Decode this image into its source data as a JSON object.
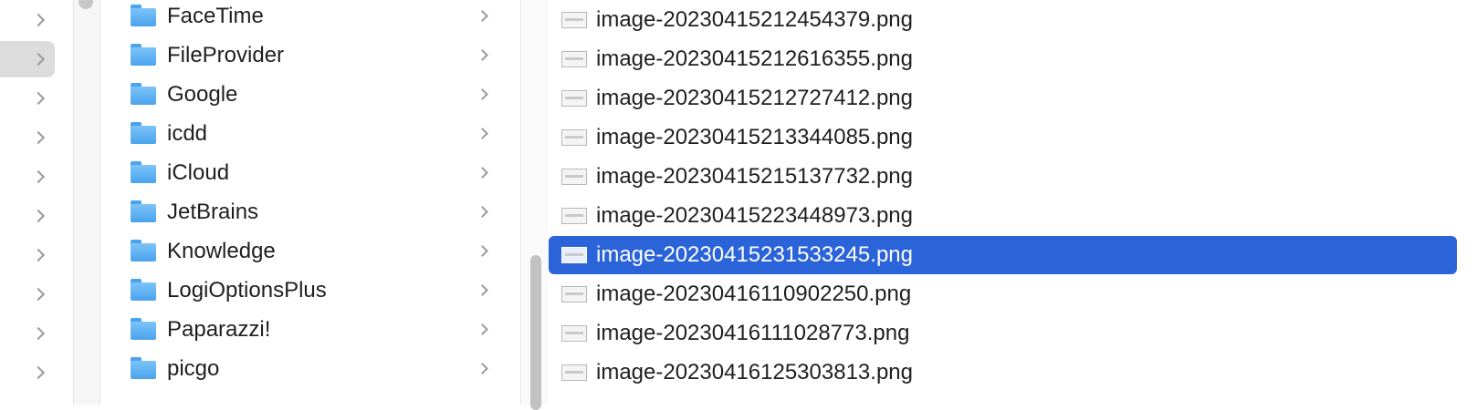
{
  "colors": {
    "selection": "#2b63d9",
    "folder": "#4aa3ec",
    "sidebar_selected": "#dcdcdc"
  },
  "column1": {
    "selected_index": 1,
    "rows": [
      "",
      "",
      "",
      "",
      "",
      "",
      "",
      "",
      "",
      ""
    ]
  },
  "column2": {
    "folders": [
      {
        "name": "FaceTime"
      },
      {
        "name": "FileProvider"
      },
      {
        "name": "Google"
      },
      {
        "name": "icdd"
      },
      {
        "name": "iCloud"
      },
      {
        "name": "JetBrains"
      },
      {
        "name": "Knowledge"
      },
      {
        "name": "LogiOptionsPlus"
      },
      {
        "name": "Paparazzi!"
      },
      {
        "name": "picgo"
      }
    ]
  },
  "column3": {
    "selected_index": 6,
    "files": [
      {
        "name": "image-20230415212454379.png"
      },
      {
        "name": "image-20230415212616355.png"
      },
      {
        "name": "image-20230415212727412.png"
      },
      {
        "name": "image-20230415213344085.png"
      },
      {
        "name": "image-20230415215137732.png"
      },
      {
        "name": "image-20230415223448973.png"
      },
      {
        "name": "image-20230415231533245.png"
      },
      {
        "name": "image-20230416110902250.png"
      },
      {
        "name": "image-20230416111028773.png"
      },
      {
        "name": "image-20230416125303813.png"
      }
    ]
  }
}
